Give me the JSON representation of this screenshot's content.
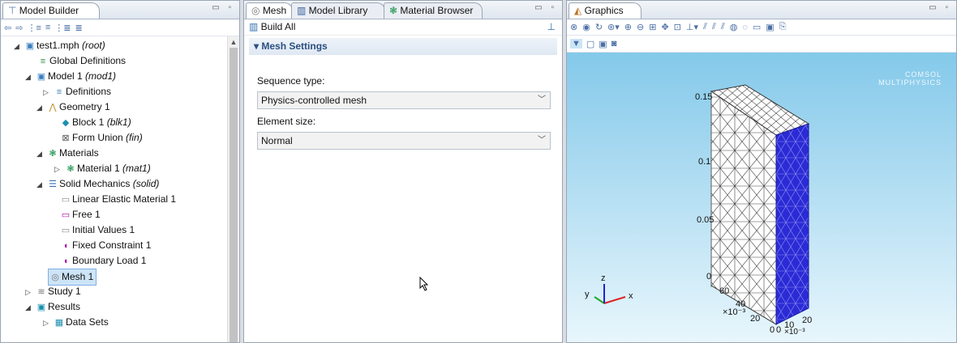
{
  "model_builder": {
    "tab_label": "Model Builder",
    "win_controls": "▭ ▫",
    "toolbar_icons": [
      "back-icon",
      "forward-icon",
      "expand-icon",
      "collapse-icon",
      "sort-icon",
      "show-icon"
    ],
    "tree": [
      {
        "label": "test1.mph",
        "suffix": "(root)",
        "arrow": "◢",
        "icon": "file-icon"
      },
      {
        "label": "Global Definitions",
        "suffix": "",
        "arrow": "",
        "icon": "global-definitions-icon"
      },
      {
        "label": "Model 1",
        "suffix": "(mod1)",
        "arrow": "◢",
        "icon": "model-icon"
      },
      {
        "label": "Definitions",
        "suffix": "",
        "arrow": "▷",
        "icon": "definitions-icon"
      },
      {
        "label": "Geometry 1",
        "suffix": "",
        "arrow": "◢",
        "icon": "geometry-icon"
      },
      {
        "label": "Block 1",
        "suffix": "(blk1)",
        "arrow": "",
        "icon": "block-icon"
      },
      {
        "label": "Form Union",
        "suffix": "(fin)",
        "arrow": "",
        "icon": "form-union-icon"
      },
      {
        "label": "Materials",
        "suffix": "",
        "arrow": "◢",
        "icon": "materials-icon"
      },
      {
        "label": "Material 1",
        "suffix": "(mat1)",
        "arrow": "▷",
        "icon": "material-icon"
      },
      {
        "label": "Solid Mechanics",
        "suffix": "(solid)",
        "arrow": "◢",
        "icon": "solid-mechanics-icon"
      },
      {
        "label": "Linear Elastic Material 1",
        "suffix": "",
        "arrow": "",
        "icon": "linear-elastic-icon"
      },
      {
        "label": "Free 1",
        "suffix": "",
        "arrow": "",
        "icon": "free-icon"
      },
      {
        "label": "Initial Values 1",
        "suffix": "",
        "arrow": "",
        "icon": "initial-values-icon"
      },
      {
        "label": "Fixed Constraint 1",
        "suffix": "",
        "arrow": "",
        "icon": "fixed-constraint-icon"
      },
      {
        "label": "Boundary Load 1",
        "suffix": "",
        "arrow": "",
        "icon": "boundary-load-icon"
      },
      {
        "label": "Mesh 1",
        "suffix": "",
        "arrow": "",
        "icon": "mesh-icon"
      },
      {
        "label": "Study 1",
        "suffix": "",
        "arrow": "▷",
        "icon": "study-icon"
      },
      {
        "label": "Results",
        "suffix": "",
        "arrow": "◢",
        "icon": "results-icon"
      },
      {
        "label": "Data Sets",
        "suffix": "",
        "arrow": "▷",
        "icon": "data-sets-icon"
      }
    ]
  },
  "middle": {
    "tabs": [
      "Mesh",
      "Model Library",
      "Material Browser"
    ],
    "win_controls": "▭ ▫",
    "build_all": "Build All",
    "section_title": "Mesh Settings",
    "sequence_label": "Sequence type:",
    "sequence_value": "Physics-controlled mesh",
    "size_label": "Element size:",
    "size_value": "Normal"
  },
  "graphics": {
    "tab_label": "Graphics",
    "win_controls": "▭ ▫",
    "logo_line1": "COMSOL",
    "logo_line2": "MULTIPHYSICS",
    "z_ticks": [
      "0.15",
      "0.1",
      "0.05",
      "0"
    ],
    "x_ticks": [
      "60",
      "40",
      "20",
      "0"
    ],
    "x_exp": "×10⁻³",
    "y_ticks": [
      "0",
      "10",
      "20"
    ],
    "y_exp": "×10⁻³",
    "triad": {
      "x": "x",
      "y": "y",
      "z": "z"
    },
    "colors": {
      "mesh_face": "#ffffff",
      "selected_face": "#2b2bd6",
      "bg_top": "#84c9ea",
      "bg_bottom": "#e8f6fc"
    }
  }
}
